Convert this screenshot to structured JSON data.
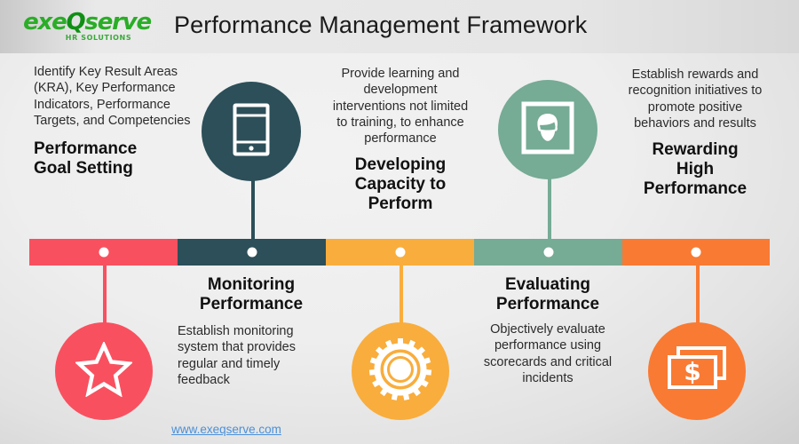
{
  "header": {
    "logo_word_a": "exe",
    "logo_word_q": "Q",
    "logo_word_b": "serve",
    "logo_tagline": "HR SOLUTIONS",
    "title": "Performance Management Framework"
  },
  "footer": {
    "url": "www.exeqserve.com"
  },
  "colors": {
    "stage1": "#f9505f",
    "stage2": "#2c4f59",
    "stage3": "#f9ad3c",
    "stage4": "#76ab95",
    "stage5": "#f97a33",
    "dot": "#ffffff",
    "link": "#4a90d9",
    "logo_green": "#2aad27",
    "title_text": "#1b1b1b"
  },
  "stages": [
    {
      "index": 1,
      "headline": "Performance\nGoal Setting",
      "description": "Identify Key Result Areas (KRA), Key Performance Indicators, Performance Targets, and Competencies",
      "icon": "star-icon",
      "color": "#f9505f",
      "position": "below"
    },
    {
      "index": 2,
      "headline": "Monitoring\nPerformance",
      "description": "Establish monitoring system that provides regular and timely feedback",
      "icon": "smartphone-icon",
      "color": "#2c4f59",
      "position": "above"
    },
    {
      "index": 3,
      "headline": "Developing\nCapacity to\nPerform",
      "description": "Provide learning and development interventions not limited to training, to enhance performance",
      "icon": "gear-icon",
      "color": "#f9ad3c",
      "position": "below"
    },
    {
      "index": 4,
      "headline": "Evaluating\nPerformance",
      "description": "Objectively evaluate performance using scorecards and critical incidents",
      "icon": "person-portrait-icon",
      "color": "#76ab95",
      "position": "above"
    },
    {
      "index": 5,
      "headline": "Rewarding\nHigh\nPerformance",
      "description": "Establish rewards and recognition initiatives to promote positive behaviors and results",
      "icon": "money-icon",
      "color": "#f97a33",
      "position": "below"
    }
  ],
  "stage_text": {
    "s1_desc": "Identify Key Result Areas (KRA), Key Performance Indicators, Performance Targets, and Competencies",
    "s1_head_l1": "Performance",
    "s1_head_l2": "Goal Setting",
    "s2_desc": "Establish monitoring system that provides regular and timely feedback",
    "s2_head_l1": "Monitoring",
    "s2_head_l2": "Performance",
    "s3_desc": "Provide learning and development interventions not limited to training, to enhance performance",
    "s3_head_l1": "Developing",
    "s3_head_l2": "Capacity to",
    "s3_head_l3": "Perform",
    "s4_desc": "Objectively evaluate performance using scorecards and critical incidents",
    "s4_head_l1": "Evaluating",
    "s4_head_l2": "Performance",
    "s5_desc": "Establish rewards and recognition initiatives to promote positive behaviors and results",
    "s5_head_l1": "Rewarding",
    "s5_head_l2": "High",
    "s5_head_l3": "Performance"
  }
}
